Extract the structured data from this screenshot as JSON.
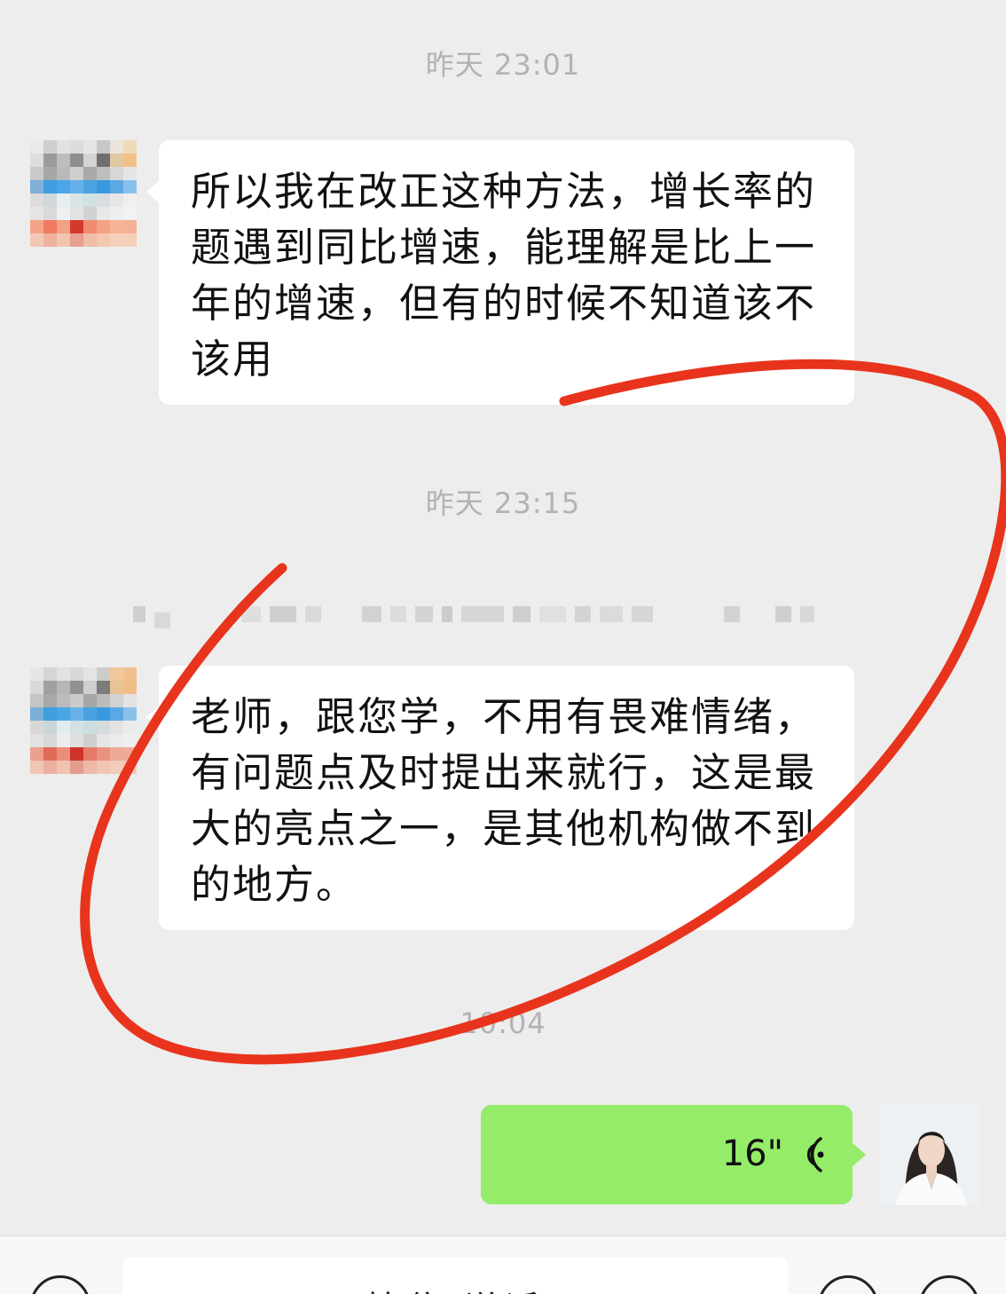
{
  "messages": [
    {
      "type": "timestamp",
      "text": "昨天 23:01"
    },
    {
      "type": "incoming",
      "text": "所以我在改正这种方法，增长率的题遇到同比增速，能理解是比上一年的增速，但有的时候不知道该不该用"
    },
    {
      "type": "timestamp",
      "text": "昨天 23:15"
    },
    {
      "type": "incoming",
      "text": "老师，跟您学，不用有畏难情绪，有问题点及时提出来就行，这是最大的亮点之一，是其他机构做不到的地方。"
    },
    {
      "type": "timestamp",
      "text": "10:04"
    },
    {
      "type": "voice-outgoing",
      "duration": "16\""
    }
  ],
  "input_bar": {
    "label": "按住 说话"
  },
  "colors": {
    "background": "#ededed",
    "incoming_bubble": "#ffffff",
    "outgoing_bubble": "#95ec69",
    "annotation": "#e8341c",
    "timestamp": "#b2b2b2"
  },
  "icons": {
    "voice": "voice-wave-icon",
    "input_left": "voice-mode-icon",
    "input_right_1": "emoji-icon",
    "input_right_2": "plus-icon"
  }
}
